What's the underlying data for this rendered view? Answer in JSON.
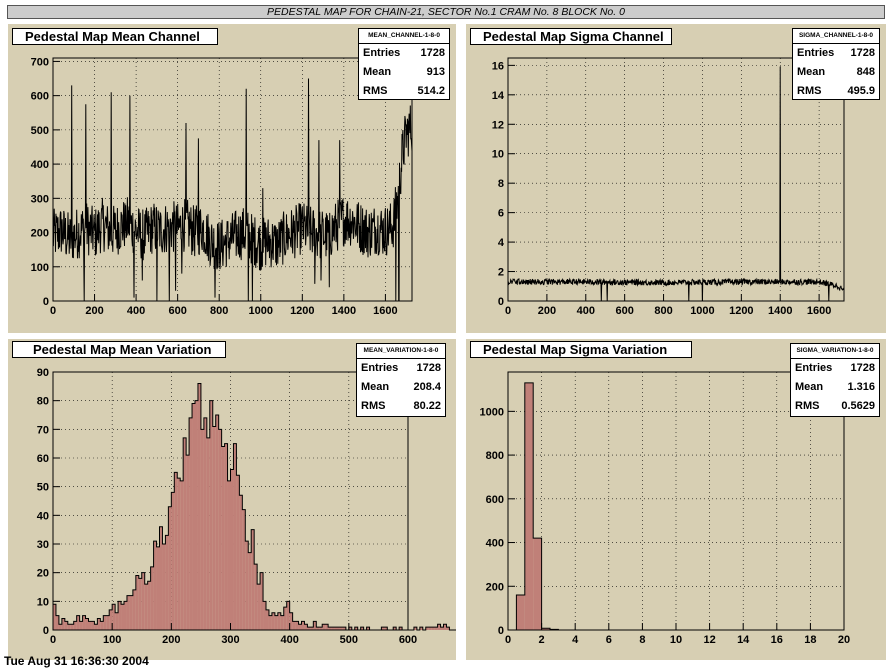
{
  "banner": "PEDESTAL MAP FOR CHAIN-21, SECTOR No.1 CRAM No. 8 BLOCK No. 0",
  "footer": "Tue Aug 31 16:36:30 2004",
  "colors": {
    "pad": "#d7cfb3",
    "hist_fill": "#c08078",
    "line": "#000000"
  },
  "panels": [
    {
      "title": "Pedestal Map Mean Channel",
      "stats": {
        "name": "MEAN_CHANNEL-1-8-0",
        "entries_label": "Entries",
        "entries": "1728",
        "mean_label": "Mean",
        "mean": "913",
        "rms_label": "RMS",
        "rms": "514.2"
      }
    },
    {
      "title": "Pedestal Map Sigma Channel",
      "stats": {
        "name": "SIGMA_CHANNEL-1-8-0",
        "entries_label": "Entries",
        "entries": "1728",
        "mean_label": "Mean",
        "mean": "848",
        "rms_label": "RMS",
        "rms": "495.9"
      }
    },
    {
      "title": "Pedestal Map Mean Variation",
      "stats": {
        "name": "MEAN_VARIATION-1-8-0",
        "entries_label": "Entries",
        "entries": "1728",
        "mean_label": "Mean",
        "mean": "208.4",
        "rms_label": "RMS",
        "rms": "80.22"
      }
    },
    {
      "title": "Pedestal Map Sigma Variation",
      "stats": {
        "name": "SIGMA_VARIATION-1-8-0",
        "entries_label": "Entries",
        "entries": "1728",
        "mean_label": "Mean",
        "mean": "1.316",
        "rms_label": "RMS",
        "rms": "0.5629"
      }
    }
  ],
  "chart_data": [
    {
      "type": "line",
      "title": "Pedestal Map Mean Channel",
      "xlim": [
        0,
        1728
      ],
      "ylim": [
        0,
        710
      ],
      "xticks": [
        0,
        200,
        400,
        600,
        800,
        1000,
        1200,
        1400,
        1600
      ],
      "yticks": [
        0,
        100,
        200,
        300,
        400,
        500,
        600,
        700
      ],
      "grid": true,
      "baseline": [
        [
          0,
          190
        ],
        [
          40,
          205
        ],
        [
          80,
          180
        ],
        [
          120,
          200
        ],
        [
          160,
          215
        ],
        [
          200,
          195
        ],
        [
          240,
          225
        ],
        [
          280,
          200
        ],
        [
          320,
          215
        ],
        [
          360,
          230
        ],
        [
          400,
          205
        ],
        [
          440,
          190
        ],
        [
          480,
          215
        ],
        [
          520,
          205
        ],
        [
          560,
          220
        ],
        [
          600,
          210
        ],
        [
          640,
          225
        ],
        [
          680,
          200
        ],
        [
          720,
          215
        ],
        [
          760,
          175
        ],
        [
          800,
          160
        ],
        [
          840,
          175
        ],
        [
          880,
          190
        ],
        [
          920,
          200
        ],
        [
          960,
          180
        ],
        [
          1000,
          165
        ],
        [
          1040,
          175
        ],
        [
          1080,
          165
        ],
        [
          1120,
          190
        ],
        [
          1160,
          200
        ],
        [
          1200,
          215
        ],
        [
          1240,
          200
        ],
        [
          1280,
          195
        ],
        [
          1320,
          190
        ],
        [
          1360,
          215
        ],
        [
          1400,
          240
        ],
        [
          1440,
          235
        ],
        [
          1480,
          215
        ],
        [
          1520,
          200
        ],
        [
          1560,
          215
        ],
        [
          1590,
          205
        ],
        [
          1620,
          210
        ],
        [
          1640,
          230
        ],
        [
          1660,
          300
        ],
        [
          1680,
          420
        ],
        [
          1700,
          490
        ],
        [
          1728,
          510
        ]
      ],
      "spikes": [
        [
          90,
          630
        ],
        [
          150,
          570
        ],
        [
          158,
          575
        ],
        [
          280,
          610
        ],
        [
          350,
          280
        ],
        [
          370,
          600
        ],
        [
          500,
          555
        ],
        [
          560,
          280
        ],
        [
          640,
          520
        ],
        [
          700,
          475
        ],
        [
          760,
          130
        ],
        [
          930,
          620
        ],
        [
          1010,
          330
        ],
        [
          1230,
          650
        ],
        [
          1280,
          470
        ],
        [
          1380,
          470
        ]
      ],
      "dips": [
        [
          150,
          0
        ],
        [
          390,
          10
        ],
        [
          430,
          60
        ],
        [
          500,
          0
        ],
        [
          560,
          0
        ],
        [
          590,
          30
        ],
        [
          620,
          80
        ],
        [
          780,
          10
        ],
        [
          940,
          0
        ],
        [
          960,
          0
        ],
        [
          1260,
          50
        ],
        [
          1290,
          60
        ],
        [
          1330,
          40
        ],
        [
          1650,
          0
        ],
        [
          1665,
          0
        ]
      ]
    },
    {
      "type": "line",
      "title": "Pedestal Map Sigma Channel",
      "xlim": [
        0,
        1728
      ],
      "ylim": [
        0,
        16.5
      ],
      "xticks": [
        0,
        200,
        400,
        600,
        800,
        1000,
        1200,
        1400,
        1600
      ],
      "yticks": [
        0,
        2,
        4,
        6,
        8,
        10,
        12,
        14,
        16
      ],
      "grid": true,
      "baseline": [
        [
          0,
          1.3
        ],
        [
          400,
          1.3
        ],
        [
          800,
          1.25
        ],
        [
          1200,
          1.3
        ],
        [
          1600,
          1.3
        ],
        [
          1700,
          1.0
        ],
        [
          1728,
          0.7
        ]
      ],
      "spikes": [
        [
          1400,
          15.9
        ]
      ],
      "dips": [
        [
          480,
          0
        ],
        [
          510,
          0
        ],
        [
          930,
          0
        ],
        [
          1000,
          0
        ],
        [
          1650,
          0
        ]
      ]
    },
    {
      "type": "bar",
      "title": "Pedestal Map Mean Variation",
      "xlim": [
        0,
        600
      ],
      "ylim": [
        0,
        90
      ],
      "bin_width": 5,
      "xticks": [
        0,
        100,
        200,
        300,
        400,
        500,
        600
      ],
      "yticks": [
        0,
        10,
        20,
        30,
        40,
        50,
        60,
        70,
        80,
        90
      ],
      "grid": true,
      "values": [
        9,
        5,
        2,
        4,
        3,
        2,
        2,
        3,
        5,
        3,
        5,
        4,
        3,
        3,
        2,
        4,
        3,
        5,
        5,
        7,
        9,
        6,
        10,
        9,
        10,
        12,
        12,
        14,
        19,
        18,
        20,
        16,
        17,
        22,
        31,
        29,
        36,
        30,
        33,
        43,
        48,
        55,
        53,
        52,
        67,
        61,
        74,
        79,
        80,
        86,
        70,
        74,
        67,
        80,
        71,
        75,
        70,
        64,
        65,
        52,
        56,
        65,
        54,
        47,
        42,
        31,
        27,
        35,
        23,
        16,
        20,
        10,
        7,
        5,
        6,
        5,
        6,
        5,
        8,
        10,
        6,
        3,
        3,
        2,
        3,
        2,
        1,
        1,
        3,
        1,
        1,
        2,
        2,
        1,
        1,
        1,
        1,
        1,
        1,
        0,
        1,
        0,
        1,
        0,
        1,
        0,
        1,
        0,
        0,
        0,
        0,
        1,
        1,
        0,
        0,
        1,
        0,
        1,
        0,
        0,
        0,
        0,
        1,
        0,
        1,
        0,
        1,
        1,
        1,
        1,
        2,
        1,
        2,
        1,
        0,
        0,
        0,
        0,
        0,
        0,
        1,
        1,
        3,
        2,
        2,
        2,
        2,
        3,
        4,
        9,
        7,
        5,
        1,
        1,
        1,
        0,
        1,
        0,
        1,
        0,
        1,
        0,
        0,
        0,
        0,
        0,
        0,
        0,
        1,
        0,
        0,
        0,
        0,
        0,
        1,
        0,
        3,
        3,
        2,
        1,
        1,
        0,
        0,
        0,
        0,
        0,
        0,
        0,
        0,
        0,
        0,
        0,
        0,
        0,
        0,
        0,
        0,
        0,
        0,
        0,
        0,
        0,
        0,
        0,
        0,
        0
      ]
    },
    {
      "type": "bar",
      "title": "Pedestal Map Sigma Variation",
      "xlim": [
        0,
        20
      ],
      "ylim": [
        0,
        1180
      ],
      "bin_width": 0.5,
      "xticks": [
        0,
        2,
        4,
        6,
        8,
        10,
        12,
        14,
        16,
        18,
        20
      ],
      "yticks": [
        0,
        200,
        400,
        600,
        800,
        1000
      ],
      "grid": true,
      "values": [
        0,
        160,
        1130,
        420,
        8,
        3,
        0,
        0,
        0,
        0,
        0,
        0,
        0,
        0,
        0,
        0,
        0,
        0,
        0,
        0,
        0,
        0,
        0,
        0,
        0,
        0,
        0,
        0,
        0,
        0,
        0,
        0,
        0,
        0,
        0,
        0,
        0,
        0,
        0,
        0
      ]
    }
  ]
}
